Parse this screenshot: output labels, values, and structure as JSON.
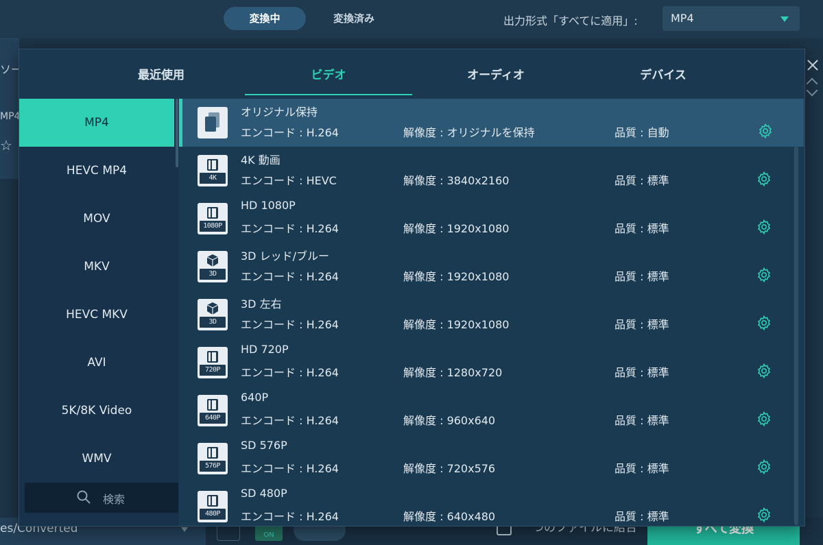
{
  "topbar": {
    "tab_converting": "変換中",
    "tab_converted": "変換済み",
    "output_label": "出力形式「すべてに適用」:",
    "output_value": "MP4"
  },
  "background": {
    "source_label": "ソー",
    "file_label": "MP4",
    "path": "es/Converted",
    "toggle": "ON",
    "merge_label": "つのファイルに結合",
    "convert_all": "すべて変換"
  },
  "modal": {
    "tabs": [
      {
        "label": "最近使用",
        "active": false
      },
      {
        "label": "ビデオ",
        "active": true
      },
      {
        "label": "オーディオ",
        "active": false
      },
      {
        "label": "デバイス",
        "active": false
      }
    ],
    "sidebar": {
      "items": [
        {
          "label": "MP4",
          "active": true
        },
        {
          "label": "HEVC MP4",
          "active": false
        },
        {
          "label": "MOV",
          "active": false
        },
        {
          "label": "MKV",
          "active": false
        },
        {
          "label": "HEVC MKV",
          "active": false
        },
        {
          "label": "AVI",
          "active": false
        },
        {
          "label": "5K/8K Video",
          "active": false
        },
        {
          "label": "WMV",
          "active": false
        }
      ],
      "search_placeholder": "検索"
    },
    "presets": [
      {
        "name": "オリジナル保持",
        "encode": "エンコード : H.264",
        "resolution": "解像度 : オリジナルを保持",
        "quality": "品質 : 自動",
        "thumb": "original",
        "badge": "",
        "selected": true
      },
      {
        "name": "4K 動画",
        "encode": "エンコード : HEVC",
        "resolution": "解像度 : 3840x2160",
        "quality": "品質 : 標準",
        "thumb": "film",
        "badge": "4K",
        "selected": false
      },
      {
        "name": "HD 1080P",
        "encode": "エンコード : H.264",
        "resolution": "解像度 : 1920x1080",
        "quality": "品質 : 標準",
        "thumb": "film",
        "badge": "1080P",
        "selected": false
      },
      {
        "name": "3D レッド/ブルー",
        "encode": "エンコード : H.264",
        "resolution": "解像度 : 1920x1080",
        "quality": "品質 : 標準",
        "thumb": "cube",
        "badge": "3D",
        "selected": false
      },
      {
        "name": "3D 左右",
        "encode": "エンコード : H.264",
        "resolution": "解像度 : 1920x1080",
        "quality": "品質 : 標準",
        "thumb": "cube",
        "badge": "3D",
        "selected": false
      },
      {
        "name": "HD 720P",
        "encode": "エンコード : H.264",
        "resolution": "解像度 : 1280x720",
        "quality": "品質 : 標準",
        "thumb": "film",
        "badge": "720P",
        "selected": false
      },
      {
        "name": "640P",
        "encode": "エンコード : H.264",
        "resolution": "解像度 : 960x640",
        "quality": "品質 : 標準",
        "thumb": "film",
        "badge": "640P",
        "selected": false
      },
      {
        "name": "SD 576P",
        "encode": "エンコード : H.264",
        "resolution": "解像度 : 720x576",
        "quality": "品質 : 標準",
        "thumb": "film",
        "badge": "576P",
        "selected": false
      },
      {
        "name": "SD 480P",
        "encode": "エンコード : H.264",
        "resolution": "解像度 : 640x480",
        "quality": "品質 : 標準",
        "thumb": "film",
        "badge": "480P",
        "selected": false
      }
    ]
  },
  "colors": {
    "accent": "#2fd0b4",
    "background": "#1c3447",
    "panel": "#18354b",
    "selected_row": "#2c5775"
  }
}
